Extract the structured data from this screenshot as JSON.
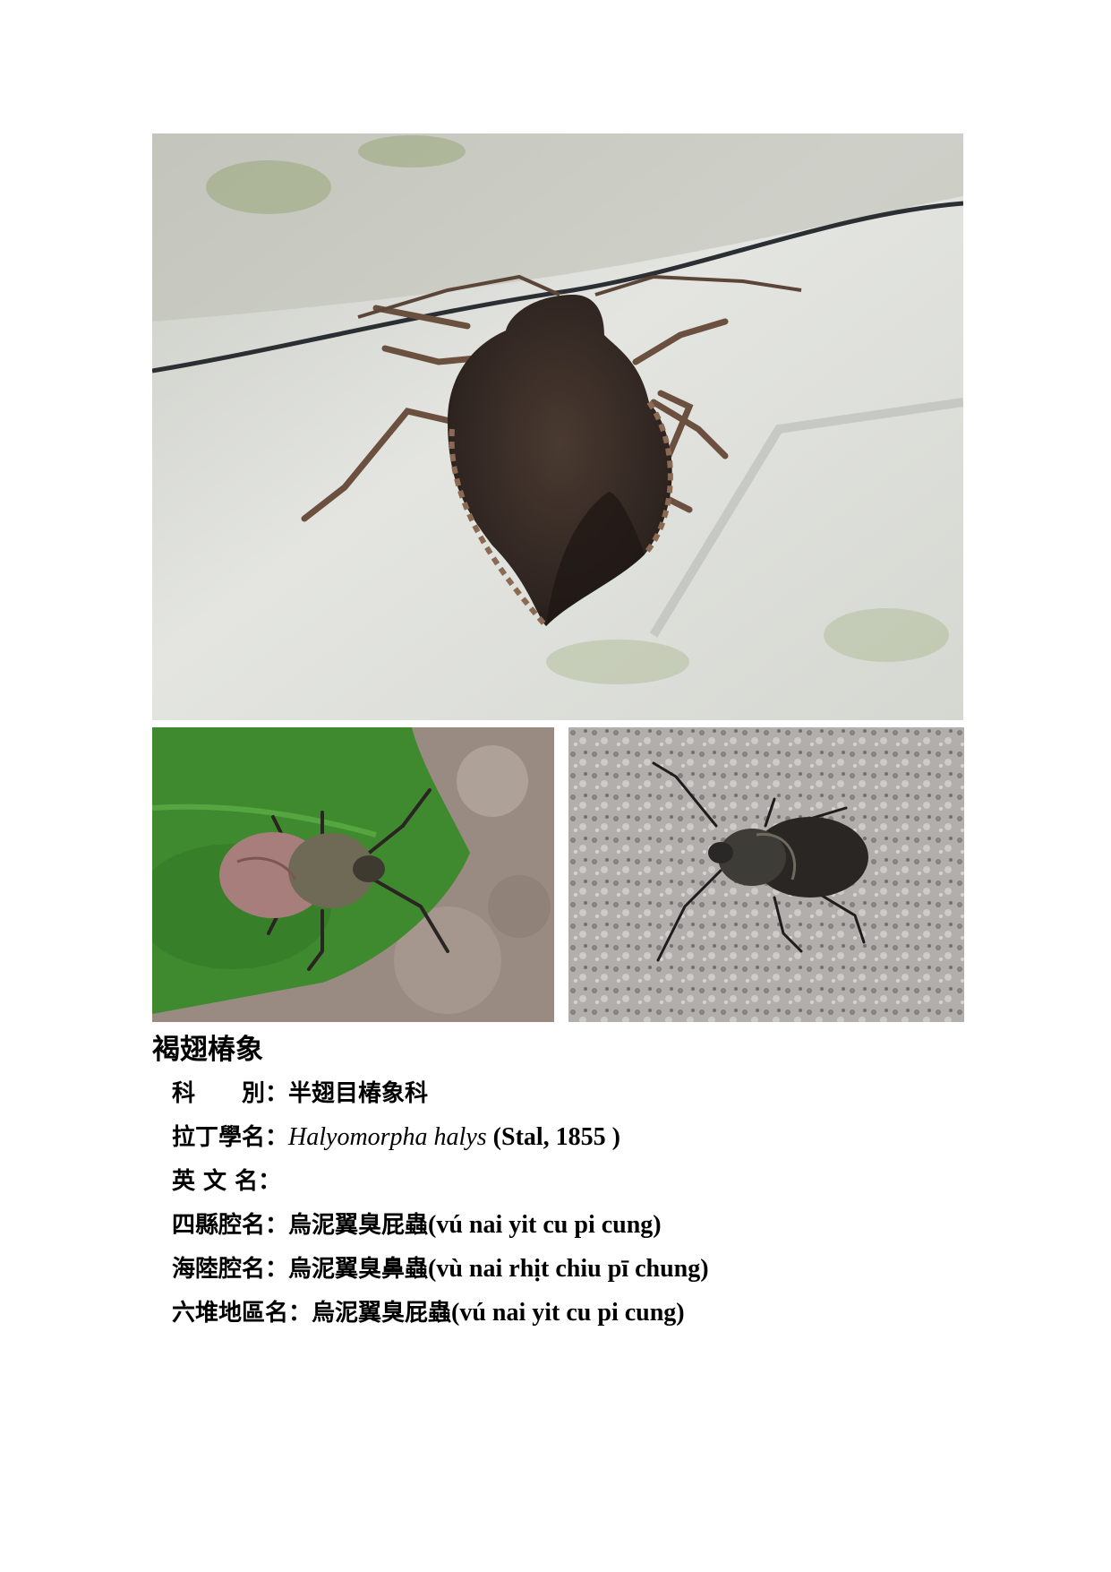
{
  "photos": {
    "main": {
      "alt": "adult-stink-bug-on-wall"
    },
    "left": {
      "alt": "nymph-on-leaf"
    },
    "right": {
      "alt": "nymph-on-rock"
    }
  },
  "species": {
    "title": "褐翅椿象",
    "family_label": "科　　別：",
    "family_value": "半翅目椿象科",
    "latin_label": "拉丁學名：",
    "latin_genus_species": "Halyomorpha halys",
    "latin_author": " (Stal, 1855 )",
    "english_label": "英 文 名：",
    "english_value": "",
    "sixian_label": "四縣腔名：",
    "sixian_cjk": "烏泥翼臭屁蟲",
    "sixian_romanization": "(vú nai yit cu pi cung)",
    "hailu_label": "海陸腔名：",
    "hailu_cjk": "烏泥翼臭鼻蟲",
    "hailu_romanization": "(vù nai rhịt chiu pī chung)",
    "liudui_label": "六堆地區名：",
    "liudui_cjk": "烏泥翼臭屁蟲",
    "liudui_romanization": "(vú nai yit cu pi cung)"
  }
}
